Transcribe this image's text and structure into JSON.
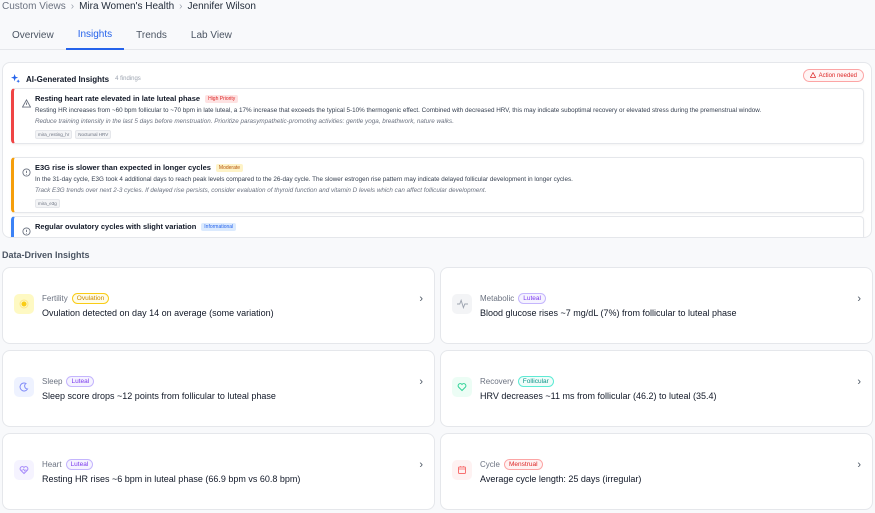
{
  "breadcrumb": {
    "root": "Custom Views",
    "org": "Mira Women's Health",
    "patient": "Jennifer Wilson"
  },
  "tabs": [
    "Overview",
    "Insights",
    "Trends",
    "Lab View"
  ],
  "active_tab": "Insights",
  "ai_panel": {
    "title": "AI-Generated Insights",
    "count": "4 findings",
    "action_label": "Action needed",
    "findings": [
      {
        "title": "Resting heart rate elevated in late luteal phase",
        "badge": "High Priority",
        "description": "Resting HR increases from ~60 bpm follicular to ~70 bpm in late luteal, a 17% increase that exceeds the typical 5-10% thermogenic effect. Combined with decreased HRV, this may indicate suboptimal recovery or elevated stress during the premenstrual window.",
        "recommendation": "Reduce training intensity in the last 5 days before menstruation. Prioritize parasympathetic-promoting activities: gentle yoga, breathwork, nature walks.",
        "tags": [
          "mira_resting_hr",
          "Nocturnal HRV"
        ]
      },
      {
        "title": "E3G rise is slower than expected in longer cycles",
        "badge": "Moderate",
        "description": "In the 31-day cycle, E3G took 4 additional days to reach peak levels compared to the 26-day cycle. The slower estrogen rise pattern may indicate delayed follicular development in longer cycles.",
        "recommendation": "Track E3G trends over next 2-3 cycles. If delayed rise persists, consider evaluation of thyroid function and vitamin D levels which can affect follicular development.",
        "tags": [
          "mira_e3g"
        ]
      },
      {
        "title": "Regular ovulatory cycles with slight variation",
        "badge": "Informational",
        "description": "",
        "recommendation": "",
        "tags": []
      }
    ]
  },
  "data_section_title": "Data-Driven Insights",
  "cards": [
    {
      "category": "Fertility",
      "phase": "Ovulation",
      "text": "Ovulation detected on day 14 on average (some variation)",
      "icon": "sun-icon"
    },
    {
      "category": "Metabolic",
      "phase": "Luteal",
      "text": "Blood glucose rises ~7 mg/dL (7%) from follicular to luteal phase",
      "icon": "pulse-icon"
    },
    {
      "category": "Sleep",
      "phase": "Luteal",
      "text": "Sleep score drops ~12 points from follicular to luteal phase",
      "icon": "moon-icon"
    },
    {
      "category": "Recovery",
      "phase": "Follicular",
      "text": "HRV decreases ~11 ms from follicular (46.2) to luteal (35.4)",
      "icon": "heart-icon"
    },
    {
      "category": "Heart",
      "phase": "Luteal",
      "text": "Resting HR rises ~6 bpm in luteal phase (66.9 bpm vs 60.8 bpm)",
      "icon": "heart-pulse-icon"
    },
    {
      "category": "Cycle",
      "phase": "Menstrual",
      "text": "Average cycle length: 25 days (irregular)",
      "icon": "calendar-icon"
    }
  ],
  "colors": {
    "accent": "#2563eb",
    "high_priority": "#ef4444",
    "moderate": "#f59e0b",
    "informational": "#3b82f6",
    "ovulation": "#eab308",
    "luteal": "#7c3aed",
    "follicular": "#14b8a6",
    "menstrual": "#ef4444"
  }
}
